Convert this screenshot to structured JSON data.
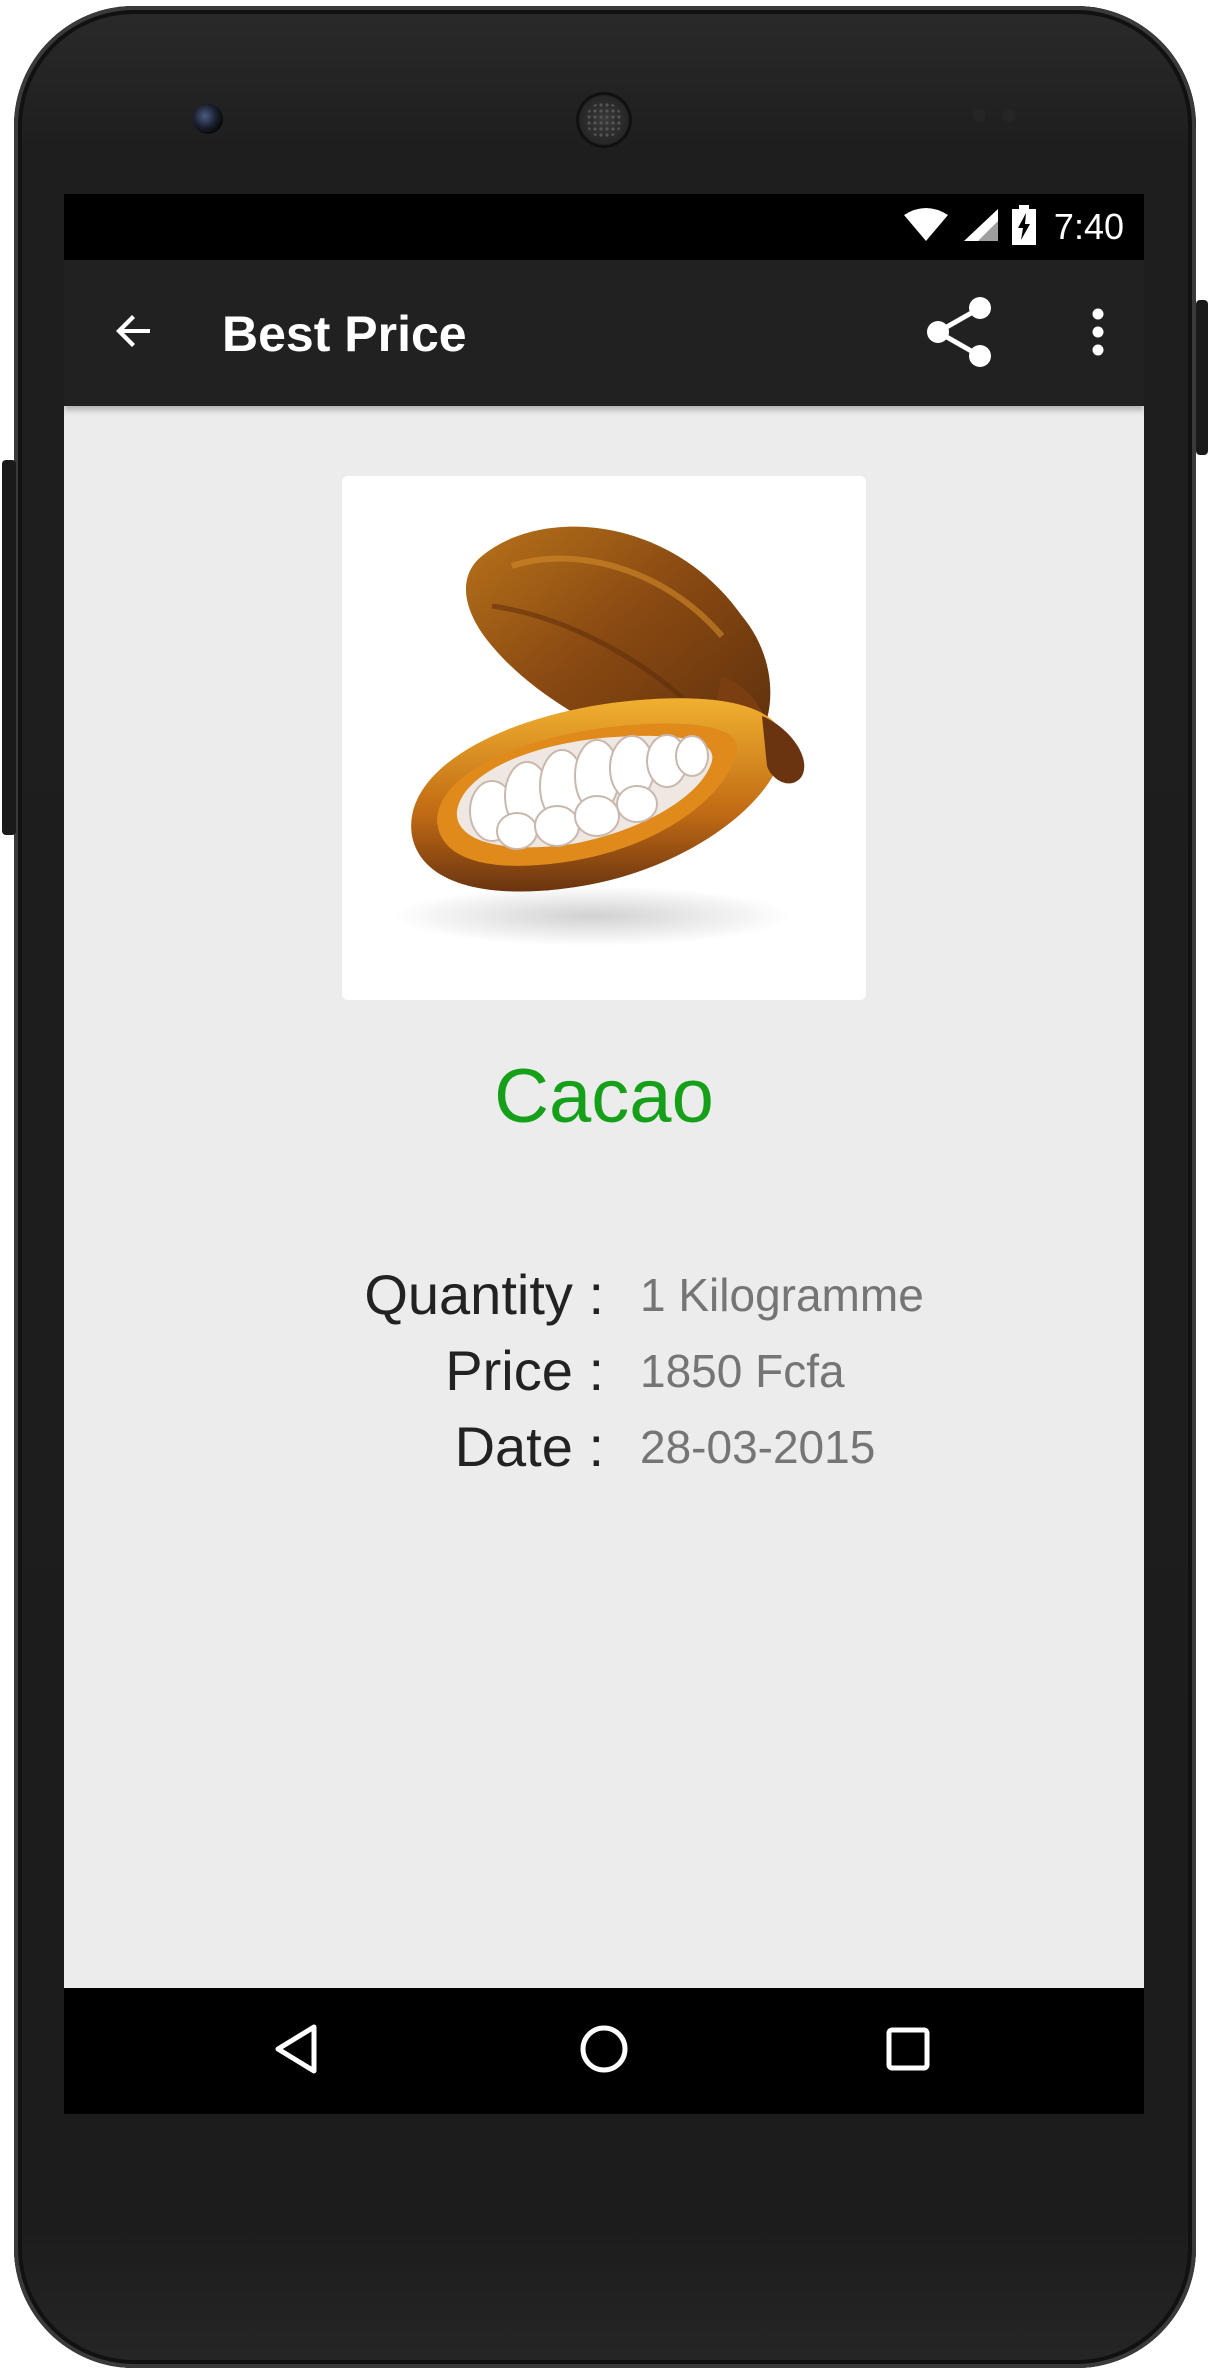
{
  "status_bar": {
    "time": "7:40",
    "icons": [
      "wifi-icon",
      "cell-signal-icon",
      "battery-charging-icon"
    ]
  },
  "app_bar": {
    "title": "Best Price",
    "actions": [
      "back-arrow-icon",
      "share-icon",
      "overflow-menu-icon"
    ]
  },
  "product": {
    "name": "Cacao",
    "name_color": "#16a01a",
    "image_alt": "cacao-pod-image"
  },
  "details": {
    "quantity_label": "Quantity :",
    "quantity_value": "1 Kilogramme",
    "price_label": "Price :",
    "price_value": "1850 Fcfa",
    "date_label": "Date :",
    "date_value": "28-03-2015"
  },
  "nav_bar": {
    "buttons": [
      "nav-back-icon",
      "nav-home-icon",
      "nav-recents-icon"
    ]
  },
  "colors": {
    "app_bar": "#212121",
    "screen_bg": "#ececec",
    "accent_green": "#16a01a",
    "value_text": "#757575"
  }
}
